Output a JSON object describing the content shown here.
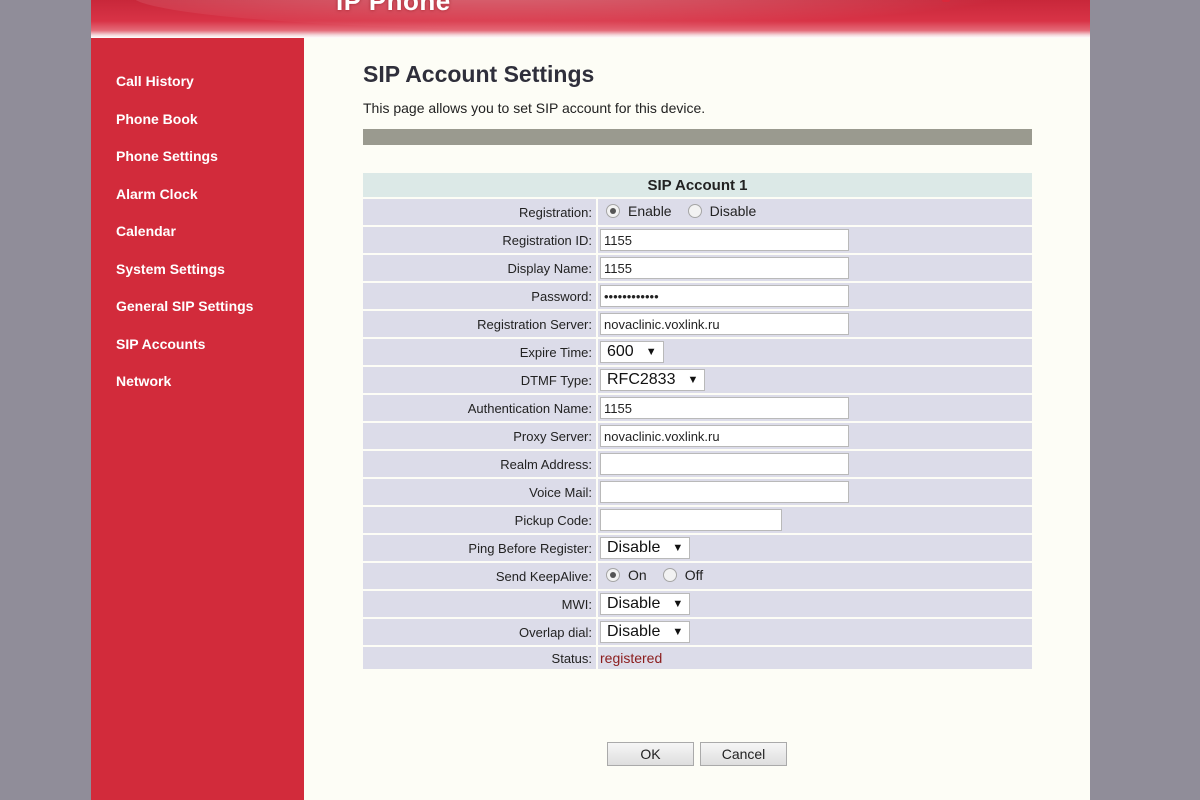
{
  "banner": {
    "title": "IP Phone"
  },
  "colors": {
    "sidebar": "#d22b3b",
    "banner": "#c8273a",
    "status": "#8b1c1c"
  },
  "sidebar": {
    "items": [
      {
        "label": "Call History"
      },
      {
        "label": "Phone Book"
      },
      {
        "label": "Phone Settings"
      },
      {
        "label": "Alarm Clock"
      },
      {
        "label": "Calendar"
      },
      {
        "label": "System Settings"
      },
      {
        "label": "General SIP Settings"
      },
      {
        "label": "SIP Accounts"
      },
      {
        "label": "Network"
      }
    ]
  },
  "main": {
    "title": "SIP Account Settings",
    "description": "This page allows you to set SIP account for this device.",
    "section_title": "SIP Account 1",
    "fields": {
      "registration": {
        "label": "Registration:",
        "options": [
          "Enable",
          "Disable"
        ],
        "selected": "Enable"
      },
      "registration_id": {
        "label": "Registration ID:",
        "value": "1155"
      },
      "display_name": {
        "label": "Display Name:",
        "value": "1155"
      },
      "password": {
        "label": "Password:",
        "value": "••••••••••••"
      },
      "registration_server": {
        "label": "Registration Server:",
        "value": "novaclinic.voxlink.ru"
      },
      "expire_time": {
        "label": "Expire Time:",
        "value": "600"
      },
      "dtmf_type": {
        "label": "DTMF Type:",
        "value": "RFC2833"
      },
      "authentication_name": {
        "label": "Authentication Name:",
        "value": "1155"
      },
      "proxy_server": {
        "label": "Proxy Server:",
        "value": "novaclinic.voxlink.ru"
      },
      "realm_address": {
        "label": "Realm Address:",
        "value": ""
      },
      "voice_mail": {
        "label": "Voice Mail:",
        "value": ""
      },
      "pickup_code": {
        "label": "Pickup Code:",
        "value": ""
      },
      "ping_before_register": {
        "label": "Ping Before Register:",
        "value": "Disable"
      },
      "send_keepalive": {
        "label": "Send KeepAlive:",
        "options": [
          "On",
          "Off"
        ],
        "selected": "On"
      },
      "mwi": {
        "label": "MWI:",
        "value": "Disable"
      },
      "overlap_dial": {
        "label": "Overlap dial:",
        "value": "Disable"
      },
      "status": {
        "label": "Status:",
        "value": "registered"
      }
    },
    "buttons": {
      "ok": "OK",
      "cancel": "Cancel"
    }
  }
}
